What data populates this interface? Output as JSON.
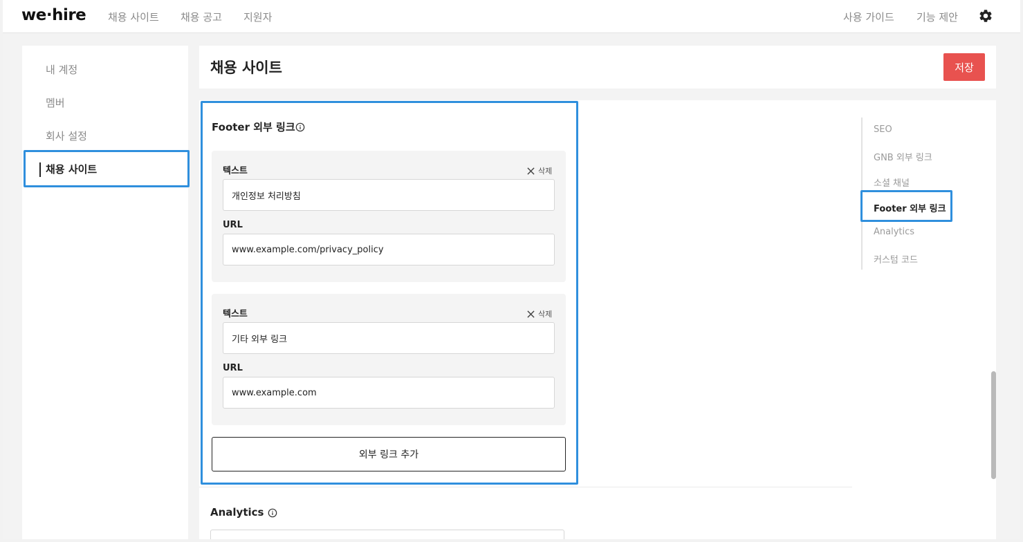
{
  "app": {
    "logo": "we·hire"
  },
  "nav": {
    "left": [
      "채용 사이트",
      "채용 공고",
      "지원자"
    ],
    "right": [
      "사용 가이드",
      "기능 제안"
    ],
    "settings_icon": "gear-icon"
  },
  "sidebar": {
    "items": [
      "내 계정",
      "멤버",
      "회사 설정"
    ],
    "active": "채용 사이트"
  },
  "header": {
    "title": "채용 사이트",
    "save_label": "저장"
  },
  "footer_links": {
    "title": "Footer 외부 링크",
    "items": [
      {
        "text_label": "텍스트",
        "text_value": "개인정보 처리방침",
        "url_label": "URL",
        "url_value": "www.example.com/privacy_policy",
        "delete_label": "삭제"
      },
      {
        "text_label": "텍스트",
        "text_value": "기타 외부 링크",
        "url_label": "URL",
        "url_value": "www.example.com",
        "delete_label": "삭제"
      }
    ],
    "add_label": "외부 링크 추가"
  },
  "analytics": {
    "title": "Analytics"
  },
  "toc": {
    "items": [
      "SEO",
      "GNB 외부 링크",
      "소셜 채널",
      "Footer 외부 링크",
      "Analytics",
      "커스텀 코드"
    ],
    "active_index": 3
  },
  "colors": {
    "accent": "#2f8fdd",
    "save": "#e8524f"
  }
}
